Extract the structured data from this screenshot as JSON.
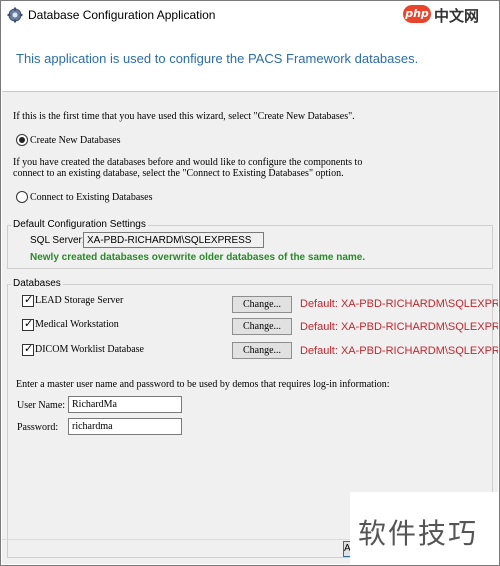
{
  "window": {
    "title": "Database Configuration Application",
    "header": "This application is used to configure the PACS Framework databases."
  },
  "watermark": {
    "top_badge": "php",
    "top_text": "中文网",
    "bottom_text": "软件技巧"
  },
  "intro": {
    "first_time_text": "If this is the first time that you have used this wizard, select \"Create New Databases\".",
    "create_option": "Create New Databases",
    "create_selected": true,
    "existing_text_line1": "If you have created the databases before and would like to configure the components to",
    "existing_text_line2": "connect to an existing database, select the \"Connect to Existing Databases\" option.",
    "connect_option": "Connect to Existing Databases",
    "connect_selected": false
  },
  "defaults": {
    "group_label": "Default Configuration Settings",
    "sql_label": "SQL Server:",
    "sql_value": "XA-PBD-RICHARDM\\SQLEXPRESS",
    "warning": "Newly created databases overwrite older databases of the same name."
  },
  "databases": {
    "group_label": "Databases",
    "change_label": "Change...",
    "items": [
      {
        "label": "LEAD Storage Server",
        "checked": true,
        "default_text": "Default: XA-PBD-RICHARDM\\SQLEXPRESS"
      },
      {
        "label": "Medical Workstation",
        "checked": true,
        "default_text": "Default: XA-PBD-RICHARDM\\SQLEXPRESS"
      },
      {
        "label": "DICOM Worklist Database",
        "checked": true,
        "default_text": "Default: XA-PBD-RICHARDM\\SQLEXPRESS"
      }
    ]
  },
  "credentials": {
    "prompt": "Enter a master user name and password to be used by demos that requires log-in information:",
    "username_label": "User Name:",
    "username_value": "RichardMa",
    "password_label": "Password:",
    "password_value": "richardma"
  },
  "footer": {
    "partial_button": "A"
  },
  "colors": {
    "header_text": "#2b6ea8",
    "default_text": "#c0282e",
    "warning_text": "#2a8a2a",
    "panel_bg": "#f0f0f0"
  }
}
